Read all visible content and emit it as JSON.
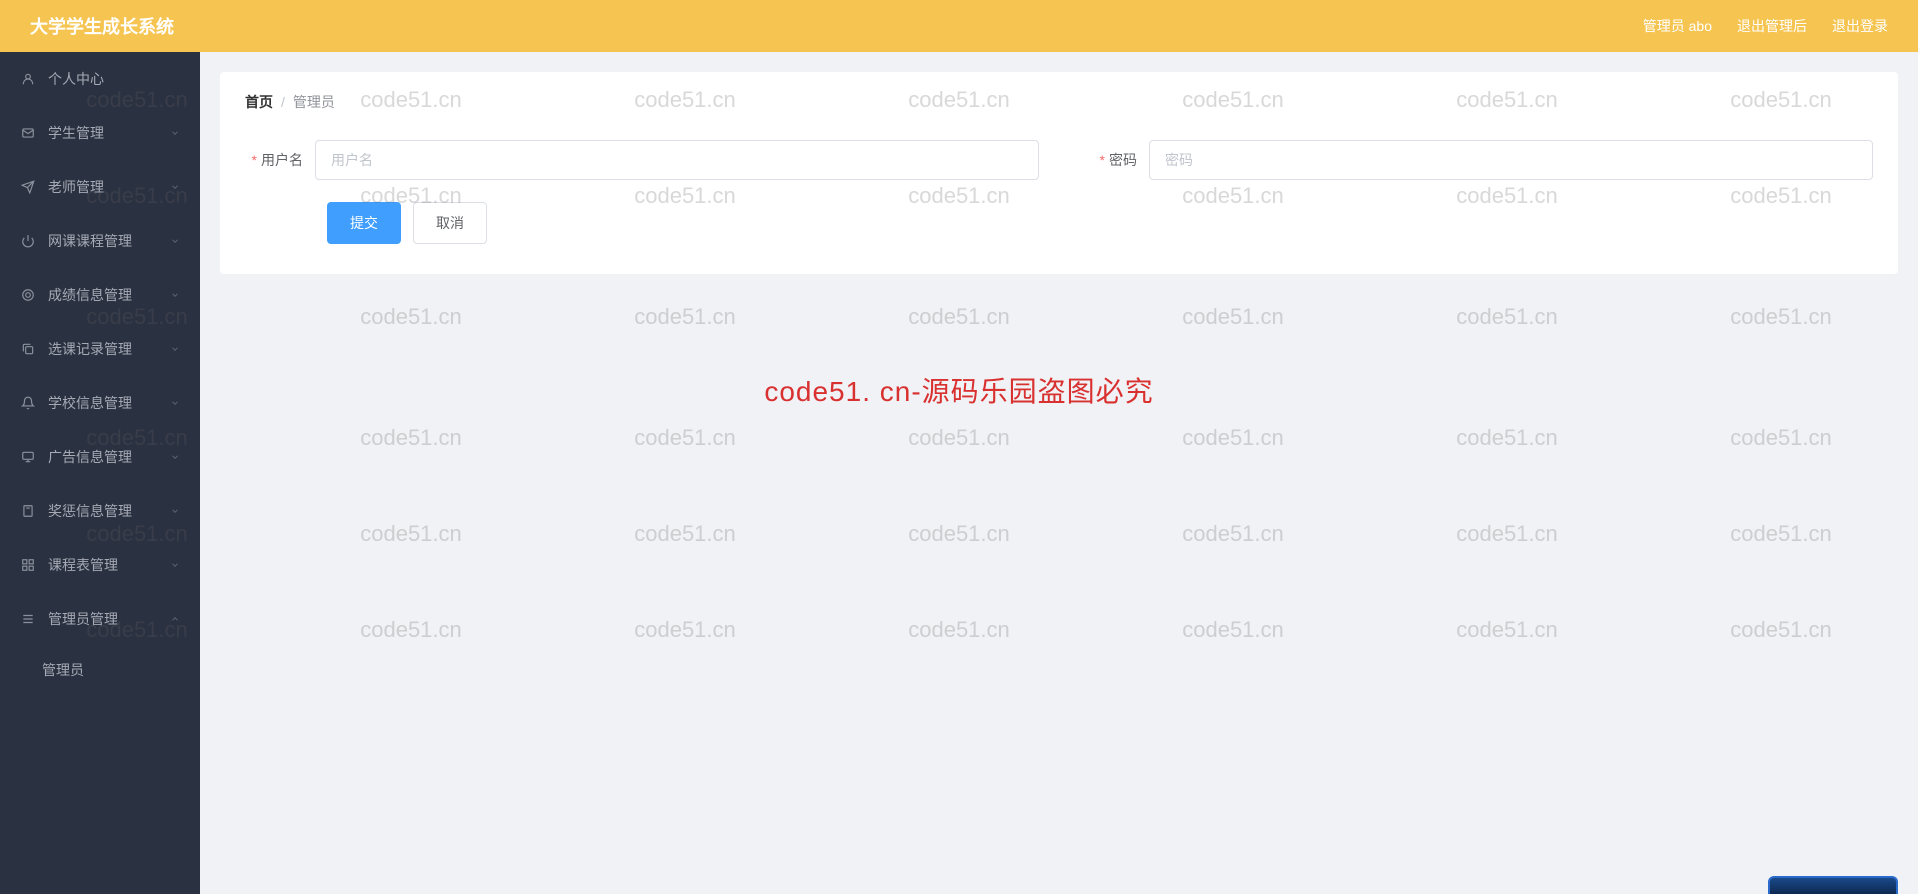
{
  "header": {
    "title": "大学学生成长系统",
    "admin_label": "管理员 abo",
    "back_label": "退出管理后",
    "logout_label": "退出登录"
  },
  "sidebar": {
    "items": [
      {
        "label": "个人中心",
        "icon": "user"
      },
      {
        "label": "学生管理",
        "icon": "mail"
      },
      {
        "label": "老师管理",
        "icon": "plane"
      },
      {
        "label": "网课课程管理",
        "icon": "power"
      },
      {
        "label": "成绩信息管理",
        "icon": "circle"
      },
      {
        "label": "选课记录管理",
        "icon": "copy"
      },
      {
        "label": "学校信息管理",
        "icon": "bell"
      },
      {
        "label": "广告信息管理",
        "icon": "monitor"
      },
      {
        "label": "奖惩信息管理",
        "icon": "bookmark"
      },
      {
        "label": "课程表管理",
        "icon": "grid"
      },
      {
        "label": "管理员管理",
        "icon": "settings"
      }
    ],
    "subitem": "管理员"
  },
  "breadcrumb": {
    "home": "首页",
    "current": "管理员"
  },
  "form": {
    "username_label": "用户名",
    "username_placeholder": "用户名",
    "password_label": "密码",
    "password_placeholder": "密码",
    "submit_label": "提交",
    "cancel_label": "取消"
  },
  "watermark": {
    "text": "code51.cn",
    "center": "code51. cn-源码乐园盗图必究"
  }
}
